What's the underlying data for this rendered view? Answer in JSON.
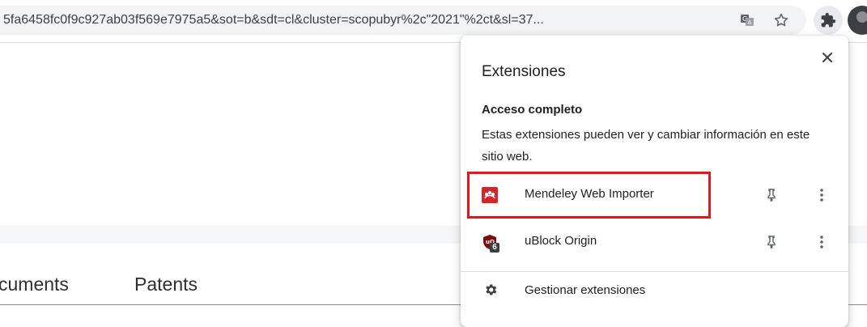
{
  "toolbar": {
    "url": "5fa6458fc0f9c927ab03f569e7975a5&sot=b&sdt=cl&cluster=scopubyr%2c\"2021\"%2ct&sl=37...",
    "translate_icon": "translate-icon",
    "bookmark_icon": "star-icon",
    "extensions_icon": "puzzle-icon",
    "profile_icon": "avatar"
  },
  "page": {
    "tabs": [
      "cuments",
      "Patents"
    ]
  },
  "extensions_popup": {
    "title": "Extensiones",
    "close_icon": "close-icon",
    "section_title": "Acceso completo",
    "section_desc": "Estas extensiones pueden ver y cambiar información en este sitio web.",
    "items": [
      {
        "name": "Mendeley Web Importer",
        "icon": "mendeley-icon",
        "color": "#d7232a",
        "pinned": false
      },
      {
        "name": "uBlock Origin",
        "icon": "ublock-icon",
        "color": "#7a0f12",
        "badge": "6",
        "pinned": false
      }
    ],
    "manage_label": "Gestionar extensiones",
    "manage_icon": "gear-icon"
  },
  "colors": {
    "highlight": "#e8141a",
    "accent": "#1a73e8"
  }
}
